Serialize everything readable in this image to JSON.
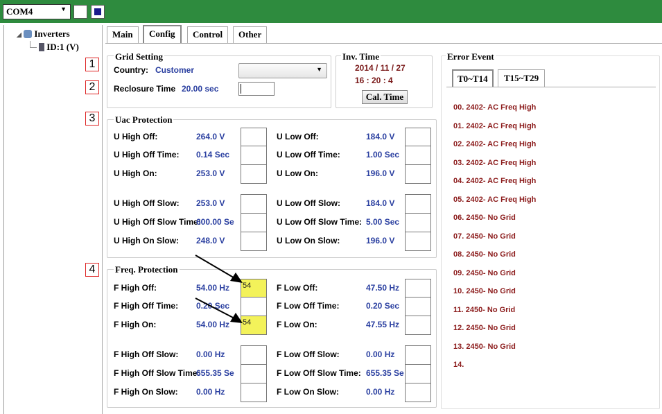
{
  "toolbar": {
    "port": "COM4"
  },
  "tree": {
    "root": "Inverters",
    "child": "ID:1 (V)"
  },
  "tabs": [
    "Main",
    "Config",
    "Control",
    "Other"
  ],
  "grid_setting": {
    "title": "Grid Setting",
    "country_label": "Country:",
    "country_value": "Customer",
    "reclosure_label": "Reclosure Time",
    "reclosure_value": "20.00 sec"
  },
  "inv_time": {
    "title": "Inv. Time",
    "date": "2014 / 11 / 27",
    "time": "16 : 20 : 4",
    "button": "Cal. Time"
  },
  "uac": {
    "title": "Uac Protection",
    "left": [
      {
        "label": "U High Off:",
        "value": "264.0 V"
      },
      {
        "label": "U High Off Time:",
        "value": "0.14 Sec"
      },
      {
        "label": "U High On:",
        "value": "253.0 V"
      },
      {
        "label": "U High Off Slow:",
        "value": "253.0 V"
      },
      {
        "label": "U High Off Slow Time:",
        "value": "600.00 Se"
      },
      {
        "label": "U High On Slow:",
        "value": "248.0 V"
      }
    ],
    "right": [
      {
        "label": "U Low Off:",
        "value": "184.0 V"
      },
      {
        "label": "U Low Off Time:",
        "value": "1.00 Sec"
      },
      {
        "label": "U Low On:",
        "value": "196.0 V"
      },
      {
        "label": "U Low Off Slow:",
        "value": "184.0 V"
      },
      {
        "label": "U Low Off Slow Time:",
        "value": "5.00 Sec"
      },
      {
        "label": "U Low On Slow:",
        "value": "196.0 V"
      }
    ]
  },
  "freq": {
    "title": "Freq. Protection",
    "left": [
      {
        "label": "F High Off:",
        "value": "54.00 Hz",
        "input": "54"
      },
      {
        "label": "F High Off Time:",
        "value": "0.20 Sec",
        "input": ""
      },
      {
        "label": "F High On:",
        "value": "54.00 Hz",
        "input": "54"
      },
      {
        "label": "F High Off Slow:",
        "value": "0.00 Hz",
        "input": ""
      },
      {
        "label": "F High Off Slow Time:",
        "value": "655.35 Se",
        "input": ""
      },
      {
        "label": "F High On Slow:",
        "value": "0.00 Hz",
        "input": ""
      }
    ],
    "right": [
      {
        "label": "F Low Off:",
        "value": "47.50 Hz"
      },
      {
        "label": "F Low Off Time:",
        "value": "0.20 Sec"
      },
      {
        "label": "F Low On:",
        "value": "47.55 Hz"
      },
      {
        "label": "F Low Off Slow:",
        "value": "0.00 Hz"
      },
      {
        "label": "F Low Off Slow Time:",
        "value": "655.35 Se"
      },
      {
        "label": "F Low On Slow:",
        "value": "0.00 Hz"
      }
    ]
  },
  "error_event": {
    "title": "Error Event",
    "tabs": [
      "T0~T14",
      "T15~T29"
    ],
    "items": [
      "00. 2402- AC Freq High",
      "01. 2402- AC Freq High",
      "02. 2402- AC Freq High",
      "03. 2402- AC Freq High",
      "04. 2402- AC Freq High",
      "05. 2402- AC Freq High",
      "06. 2450- No Grid",
      "07. 2450- No Grid",
      "08. 2450- No Grid",
      "09. 2450- No Grid",
      "10. 2450- No Grid",
      "11. 2450- No Grid",
      "12. 2450- No Grid",
      "13. 2450- No Grid",
      "14."
    ]
  },
  "callouts": [
    "1",
    "2",
    "3",
    "4"
  ]
}
